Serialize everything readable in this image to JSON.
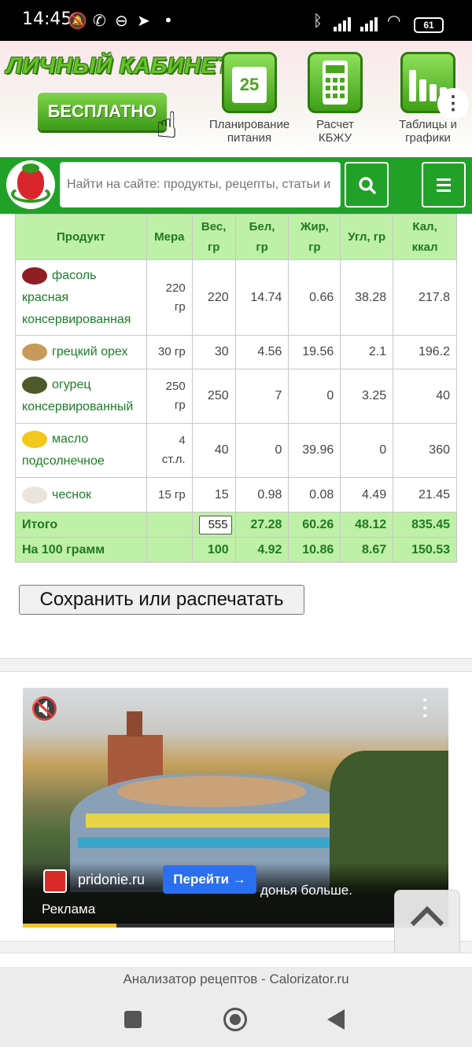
{
  "status_bar": {
    "time": "14:45",
    "battery": "61",
    "icons": [
      "mute-icon",
      "viber-icon",
      "app-icon",
      "telegram-icon",
      "dot-icon",
      "bluetooth-icon",
      "signal-icon",
      "signal-icon",
      "wifi-icon",
      "battery-icon"
    ]
  },
  "banner": {
    "title": "ЛИЧНЫЙ КАБИНЕТ",
    "free_button": "БЕСПЛАТНО",
    "features": [
      {
        "icon": "calendar-icon",
        "icon_text": "25",
        "label_line1": "Планирование",
        "label_line2": "питания"
      },
      {
        "icon": "calculator-icon",
        "label_line1": "Расчет",
        "label_line2": "КБЖУ"
      },
      {
        "icon": "bar-chart-icon",
        "label_line1": "Таблицы и",
        "label_line2": "графики"
      }
    ],
    "more_icon": "⋮"
  },
  "header": {
    "search_placeholder": "Найти на сайте: продукты, рецепты, статьи и"
  },
  "table": {
    "columns": [
      {
        "line1": "Продукт",
        "line2": ""
      },
      {
        "line1": "Мера",
        "line2": ""
      },
      {
        "line1": "Вес,",
        "line2": "гр"
      },
      {
        "line1": "Бел,",
        "line2": "гр"
      },
      {
        "line1": "Жир,",
        "line2": "гр"
      },
      {
        "line1": "Угл, гр",
        "line2": ""
      },
      {
        "line1": "Кал,",
        "line2": "ккал"
      }
    ],
    "rows": [
      {
        "name_line1": "фасоль",
        "name_line2": "красная",
        "name_line3": "консервированная",
        "measure_line1": "220",
        "measure_line2": "гр",
        "weight": "220",
        "protein": "14.74",
        "fat": "0.66",
        "carbs": "38.28",
        "kcal": "217.8",
        "img_color": "#8e1e24"
      },
      {
        "name_line1": "грецкий орех",
        "name_line2": "",
        "name_line3": "",
        "measure_line1": "30 гр",
        "measure_line2": "",
        "weight": "30",
        "protein": "4.56",
        "fat": "19.56",
        "carbs": "2.1",
        "kcal": "196.2",
        "img_color": "#c79a5b"
      },
      {
        "name_line1": "огурец",
        "name_line2": "консервированный",
        "name_line3": "",
        "measure_line1": "250",
        "measure_line2": "гр",
        "weight": "250",
        "protein": "7",
        "fat": "0",
        "carbs": "3.25",
        "kcal": "40",
        "img_color": "#4d5a2a"
      },
      {
        "name_line1": "масло",
        "name_line2": "подсолнечное",
        "name_line3": "",
        "measure_line1": "4",
        "measure_line2": "ст.л.",
        "weight": "40",
        "protein": "0",
        "fat": "39.96",
        "carbs": "0",
        "kcal": "360",
        "img_color": "#f2c81c"
      },
      {
        "name_line1": "чеснок",
        "name_line2": "",
        "name_line3": "",
        "measure_line1": "15 гр",
        "measure_line2": "",
        "weight": "15",
        "protein": "0.98",
        "fat": "0.08",
        "carbs": "4.49",
        "kcal": "21.45",
        "img_color": "#ebe4dc"
      }
    ],
    "total": {
      "label": "Итого",
      "weight": "555",
      "protein": "27.28",
      "fat": "60.26",
      "carbs": "48.12",
      "kcal": "835.45"
    },
    "per100": {
      "label": "На 100 грамм",
      "weight": "100",
      "protein": "4.92",
      "fat": "10.86",
      "carbs": "8.67",
      "kcal": "150.53"
    }
  },
  "save_button": "Сохранить или распечатать",
  "ad": {
    "advertiser": "pridonie.ru",
    "go_button": "Перейти →",
    "caption": "донья больше.",
    "label": "Реклама",
    "progress": 0.22
  },
  "browser": {
    "page_title": "Анализатор рецептов - Calorizator.ru"
  },
  "colors": {
    "brand_green": "#21a127",
    "table_header_bg": "#bff0a7",
    "link_green": "#1b7d26",
    "ad_button_blue": "#2a6ff0"
  }
}
